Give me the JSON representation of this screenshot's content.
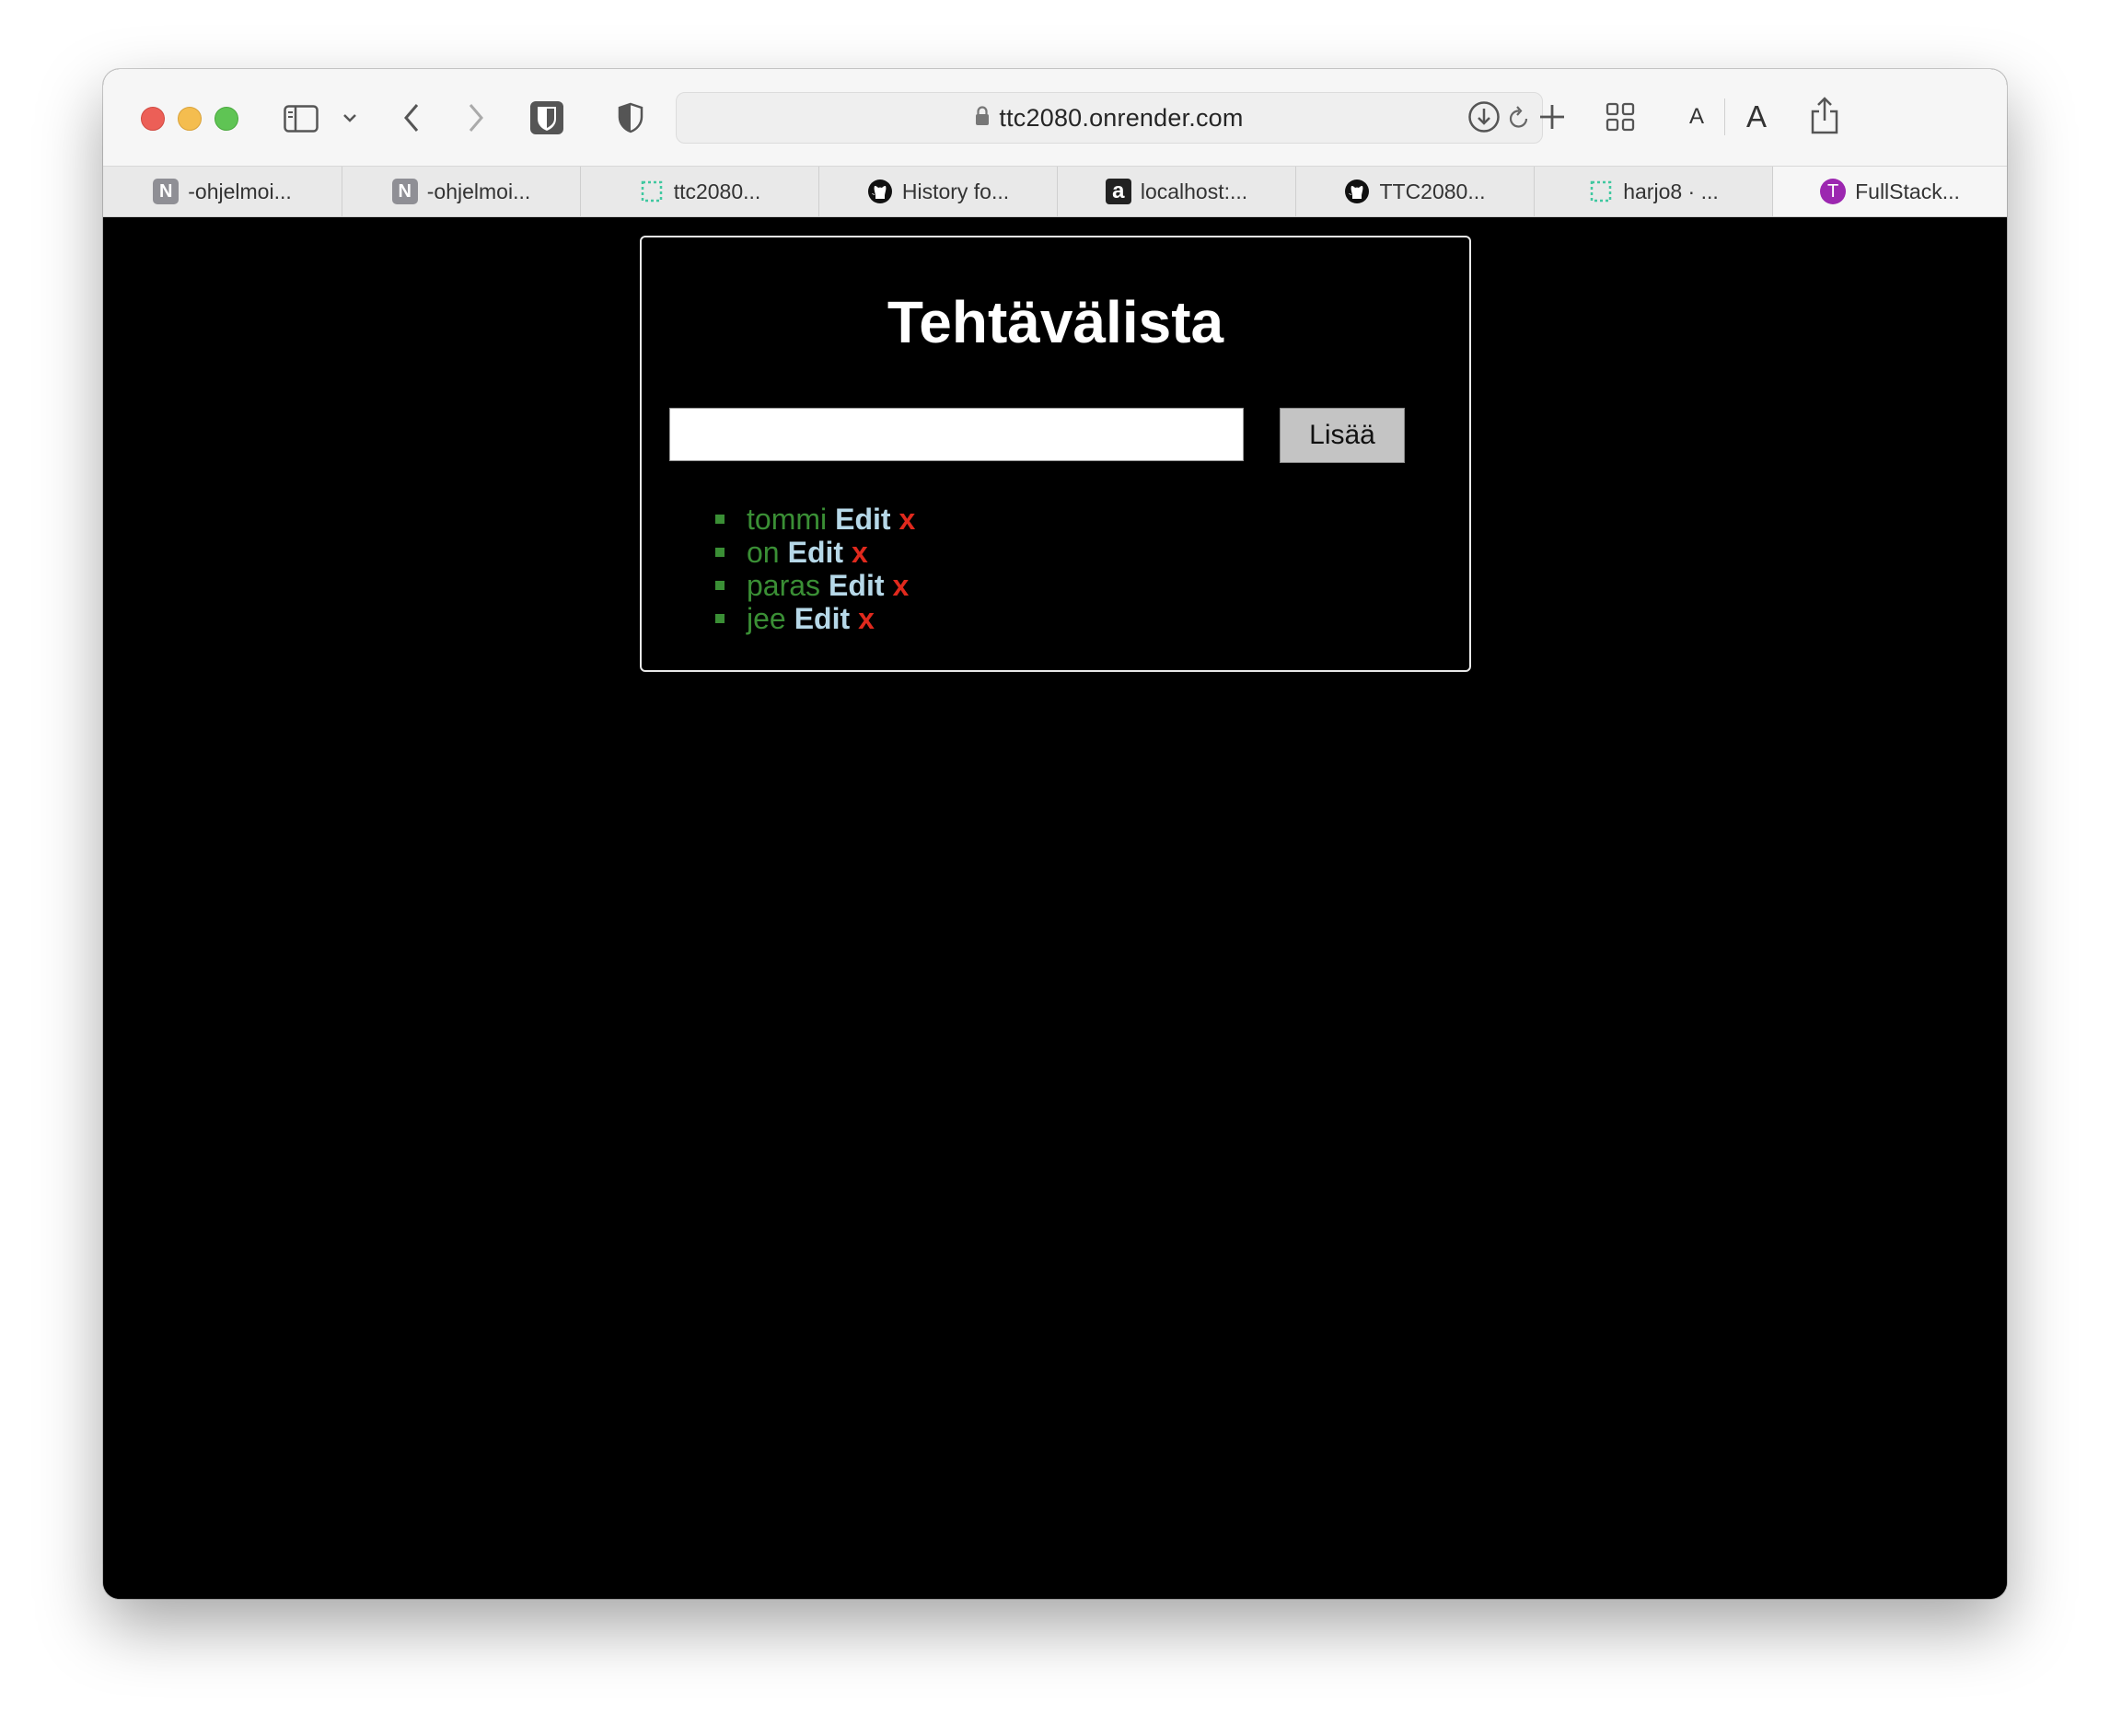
{
  "browser": {
    "url": "ttc2080.onrender.com",
    "font_small_label": "A",
    "font_large_label": "A",
    "tabs": [
      {
        "title": "-ohjelmoi...",
        "favicon": "notion-icon",
        "favicon_text": "N",
        "active": false
      },
      {
        "title": "-ohjelmoi...",
        "favicon": "notion-icon",
        "favicon_text": "N",
        "active": false
      },
      {
        "title": "ttc2080...",
        "favicon": "render-icon",
        "active": false
      },
      {
        "title": "History fo...",
        "favicon": "github-icon",
        "active": false
      },
      {
        "title": "localhost:...",
        "favicon": "a-icon",
        "favicon_text": "a",
        "active": false
      },
      {
        "title": "TTC2080...",
        "favicon": "github-icon",
        "active": false
      },
      {
        "title": "harjo8 · ...",
        "favicon": "render-icon",
        "active": false
      },
      {
        "title": "FullStack...",
        "favicon": "t-avatar-icon",
        "favicon_text": "T",
        "active": true
      }
    ]
  },
  "page": {
    "title": "Tehtävälista",
    "input": {
      "value": "",
      "placeholder": ""
    },
    "add_button": "Lisää",
    "todos": [
      {
        "text": "tommi",
        "edit": "Edit",
        "delete": "x"
      },
      {
        "text": "on",
        "edit": "Edit",
        "delete": "x"
      },
      {
        "text": "paras",
        "edit": "Edit",
        "delete": "x"
      },
      {
        "text": "jee",
        "edit": "Edit",
        "delete": "x"
      }
    ]
  },
  "colors": {
    "page_background": "#000000",
    "todo_text": "#3a8f35",
    "edit_link": "#b6d8e8",
    "delete_link": "#e0291d"
  }
}
